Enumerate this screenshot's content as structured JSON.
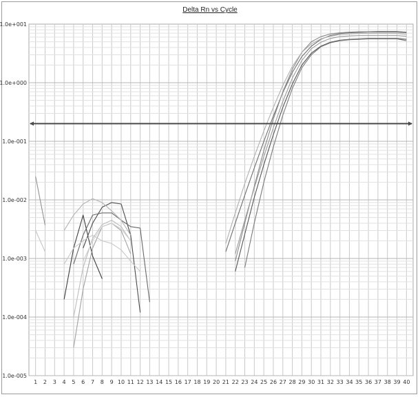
{
  "chart_data": {
    "type": "line",
    "title": "Delta Rn vs Cycle",
    "xlabel": "",
    "ylabel": "",
    "y_scale": "log",
    "xlim": [
      0.3,
      40.7
    ],
    "ylim": [
      1e-05,
      10
    ],
    "x_ticks": [
      1,
      2,
      3,
      4,
      5,
      6,
      7,
      8,
      9,
      10,
      11,
      12,
      13,
      14,
      15,
      16,
      17,
      18,
      19,
      20,
      21,
      22,
      23,
      24,
      25,
      26,
      27,
      28,
      29,
      30,
      31,
      32,
      33,
      34,
      35,
      36,
      37,
      38,
      39,
      40
    ],
    "y_tick_labels": [
      "1.0e+001",
      "1.0e+000",
      "1.0e-001",
      "1.0e-002",
      "1.0e-003",
      "1.0e-004",
      "1.0e-005"
    ],
    "y_tick_values": [
      10,
      1,
      0.1,
      0.01,
      0.001,
      0.0001,
      1e-05
    ],
    "grid": true,
    "threshold": 0.2,
    "threshold_color": "#4a4a4a",
    "series": [
      {
        "color": "#6e6e6e",
        "points": [
          [
            21,
            0.0013
          ],
          [
            22,
            0.004
          ],
          [
            23,
            0.012
          ],
          [
            24,
            0.035
          ],
          [
            25,
            0.1
          ],
          [
            26,
            0.27
          ],
          [
            27,
            0.68
          ],
          [
            28,
            1.5
          ],
          [
            29,
            2.8
          ],
          [
            30,
            4.2
          ],
          [
            31,
            5.5
          ],
          [
            32,
            6.4
          ],
          [
            33,
            6.9
          ],
          [
            34,
            7.1
          ],
          [
            35,
            7.2
          ],
          [
            36,
            7.3
          ],
          [
            37,
            7.3
          ],
          [
            38,
            7.3
          ],
          [
            39,
            7.3
          ],
          [
            40,
            7.1
          ]
        ]
      },
      {
        "color": "#8a8a8a",
        "points": [
          [
            22,
            0.0009
          ],
          [
            23,
            0.004
          ],
          [
            24,
            0.017
          ],
          [
            25,
            0.07
          ],
          [
            26,
            0.24
          ],
          [
            27,
            0.7
          ],
          [
            28,
            1.7
          ],
          [
            29,
            3.3
          ],
          [
            30,
            5.0
          ],
          [
            31,
            6.1
          ],
          [
            32,
            6.8
          ],
          [
            33,
            7.1
          ],
          [
            34,
            7.3
          ],
          [
            35,
            7.4
          ],
          [
            36,
            7.4
          ],
          [
            37,
            7.5
          ],
          [
            38,
            7.5
          ],
          [
            39,
            7.5
          ],
          [
            40,
            7.3
          ]
        ]
      },
      {
        "color": "#555555",
        "points": [
          [
            22,
            0.0006
          ],
          [
            23,
            0.0026
          ],
          [
            24,
            0.011
          ],
          [
            25,
            0.04
          ],
          [
            26,
            0.13
          ],
          [
            27,
            0.38
          ],
          [
            28,
            0.95
          ],
          [
            29,
            2.0
          ],
          [
            30,
            3.2
          ],
          [
            31,
            4.2
          ],
          [
            32,
            4.9
          ],
          [
            33,
            5.3
          ],
          [
            34,
            5.5
          ],
          [
            35,
            5.6
          ],
          [
            36,
            5.7
          ],
          [
            37,
            5.7
          ],
          [
            38,
            5.7
          ],
          [
            39,
            5.7
          ],
          [
            40,
            5.5
          ]
        ]
      },
      {
        "color": "#9c9c9c",
        "points": [
          [
            22,
            0.0012
          ],
          [
            23,
            0.0045
          ],
          [
            24,
            0.016
          ],
          [
            25,
            0.055
          ],
          [
            26,
            0.17
          ],
          [
            27,
            0.48
          ],
          [
            28,
            1.2
          ],
          [
            29,
            2.4
          ],
          [
            30,
            3.8
          ],
          [
            31,
            4.9
          ],
          [
            32,
            5.7
          ],
          [
            33,
            6.1
          ],
          [
            34,
            6.3
          ],
          [
            35,
            6.4
          ],
          [
            36,
            6.4
          ],
          [
            37,
            6.4
          ],
          [
            38,
            6.4
          ],
          [
            39,
            6.4
          ],
          [
            40,
            6.2
          ]
        ]
      },
      {
        "color": "#7a7a7a",
        "points": [
          [
            23,
            0.0007
          ],
          [
            24,
            0.004
          ],
          [
            25,
            0.02
          ],
          [
            26,
            0.08
          ],
          [
            27,
            0.28
          ],
          [
            28,
            0.8
          ],
          [
            29,
            1.8
          ],
          [
            30,
            3.0
          ],
          [
            31,
            4.1
          ],
          [
            32,
            4.8
          ],
          [
            33,
            5.2
          ],
          [
            34,
            5.4
          ],
          [
            35,
            5.5
          ],
          [
            36,
            5.6
          ],
          [
            37,
            5.6
          ],
          [
            38,
            5.6
          ],
          [
            39,
            5.6
          ],
          [
            40,
            5.2
          ]
        ]
      },
      {
        "color": "#b0b0b0",
        "points": [
          [
            21,
            0.0018
          ],
          [
            22,
            0.006
          ],
          [
            23,
            0.019
          ],
          [
            24,
            0.055
          ],
          [
            25,
            0.15
          ],
          [
            26,
            0.38
          ],
          [
            27,
            0.9
          ],
          [
            28,
            1.9
          ],
          [
            29,
            3.3
          ],
          [
            30,
            4.6
          ],
          [
            31,
            5.6
          ],
          [
            32,
            6.2
          ],
          [
            33,
            6.6
          ],
          [
            34,
            6.8
          ],
          [
            35,
            6.9
          ],
          [
            36,
            6.9
          ],
          [
            37,
            6.9
          ],
          [
            38,
            6.9
          ],
          [
            39,
            6.9
          ],
          [
            40,
            6.7
          ]
        ]
      },
      {
        "color": "#909090",
        "points": [
          [
            1,
            0.025
          ],
          [
            2,
            0.0037
          ]
        ]
      },
      {
        "color": "#c4c4c4",
        "points": [
          [
            1,
            0.003
          ],
          [
            2,
            0.0013
          ]
        ]
      },
      {
        "color": "#3c3c3c",
        "points": [
          [
            4,
            0.0002
          ],
          [
            5,
            0.0015
          ],
          [
            6,
            0.0055
          ],
          [
            7,
            0.0011
          ],
          [
            8,
            0.00045
          ]
        ]
      },
      {
        "color": "#4a4a4a",
        "points": [
          [
            6,
            0.0015
          ],
          [
            7,
            0.004
          ],
          [
            8,
            0.0075
          ],
          [
            9,
            0.009
          ],
          [
            10,
            0.0085
          ],
          [
            11,
            0.0025
          ],
          [
            12,
            0.00012
          ]
        ]
      },
      {
        "color": "#686868",
        "points": [
          [
            5,
            0.0008
          ],
          [
            6,
            0.0025
          ],
          [
            7,
            0.0055
          ],
          [
            8,
            0.006
          ],
          [
            9,
            0.006
          ],
          [
            10,
            0.0045
          ],
          [
            11,
            0.0035
          ],
          [
            12,
            0.0033
          ],
          [
            13,
            0.00018
          ]
        ]
      },
      {
        "color": "#b4b4b4",
        "points": [
          [
            4,
            0.003
          ],
          [
            5,
            0.0055
          ],
          [
            6,
            0.0085
          ],
          [
            7,
            0.0105
          ],
          [
            8,
            0.009
          ],
          [
            9,
            0.0065
          ],
          [
            10,
            0.0045
          ],
          [
            11,
            0.0025
          ]
        ]
      },
      {
        "color": "#a2a2a2",
        "points": [
          [
            5,
            3e-05
          ],
          [
            6,
            0.0003
          ],
          [
            7,
            0.0015
          ],
          [
            8,
            0.0035
          ],
          [
            9,
            0.004
          ],
          [
            10,
            0.003
          ],
          [
            11,
            0.0012
          ]
        ]
      },
      {
        "color": "#c8c8c8",
        "points": [
          [
            4,
            0.0008
          ],
          [
            5,
            0.0015
          ],
          [
            6,
            0.002
          ],
          [
            7,
            0.0025
          ],
          [
            8,
            0.002
          ],
          [
            9,
            0.0018
          ],
          [
            10,
            0.0014
          ],
          [
            11,
            0.0009
          ],
          [
            12,
            0.0006
          ]
        ]
      },
      {
        "color": "#bdbdbd",
        "points": [
          [
            5,
            0.0001
          ],
          [
            6,
            0.0007
          ],
          [
            7,
            0.0022
          ],
          [
            8,
            0.0038
          ],
          [
            9,
            0.0045
          ],
          [
            10,
            0.0035
          ],
          [
            11,
            0.002
          ]
        ]
      },
      {
        "color": "#d0d0d0",
        "points": [
          [
            6,
            0.0009
          ],
          [
            7,
            0.002
          ],
          [
            8,
            0.0035
          ],
          [
            9,
            0.004
          ],
          [
            10,
            0.0032
          ],
          [
            11,
            0.002
          ]
        ]
      }
    ]
  }
}
